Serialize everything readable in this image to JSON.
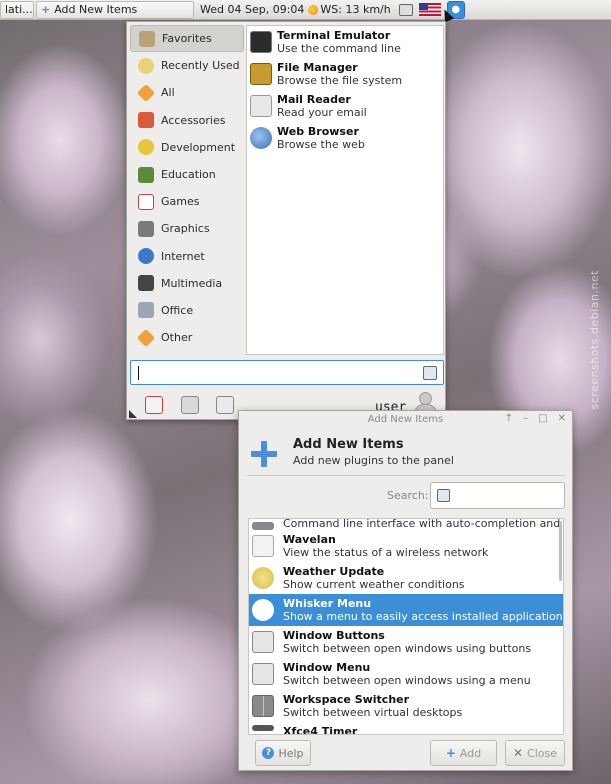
{
  "panel": {
    "task1_label": "lati...",
    "task2_label": "Add New Items",
    "clock": "Wed 04 Sep, 09:04",
    "weather": "WS: 13 km/h"
  },
  "menu": {
    "categories": [
      {
        "label": "Favorites",
        "icon": "favorites-icon",
        "color": "#b9a27a"
      },
      {
        "label": "Recently Used",
        "icon": "clock-icon",
        "color": "#e8d27a"
      },
      {
        "label": "All",
        "icon": "all-icon",
        "color": "#f0a03c"
      },
      {
        "label": "Accessories",
        "icon": "accessories-icon",
        "color": "#d95a3a"
      },
      {
        "label": "Development",
        "icon": "development-icon",
        "color": "#e8c63c"
      },
      {
        "label": "Education",
        "icon": "education-icon",
        "color": "#5a8a3a"
      },
      {
        "label": "Games",
        "icon": "games-icon",
        "color": "#c94040"
      },
      {
        "label": "Graphics",
        "icon": "graphics-icon",
        "color": "#7a7a7a"
      },
      {
        "label": "Internet",
        "icon": "internet-icon",
        "color": "#3c7ac9"
      },
      {
        "label": "Multimedia",
        "icon": "multimedia-icon",
        "color": "#444444"
      },
      {
        "label": "Office",
        "icon": "office-icon",
        "color": "#9aa6b5"
      },
      {
        "label": "Other",
        "icon": "other-icon",
        "color": "#f0a03c"
      }
    ],
    "apps": [
      {
        "title": "Terminal Emulator",
        "desc": "Use the command line",
        "icon": "terminal-icon",
        "color": "#2c2c2c"
      },
      {
        "title": "File Manager",
        "desc": "Browse the file system",
        "icon": "file-manager-icon",
        "color": "#c99a2e"
      },
      {
        "title": "Mail Reader",
        "desc": "Read your email",
        "icon": "mail-icon",
        "color": "#d8d8d8"
      },
      {
        "title": "Web Browser",
        "desc": "Browse the web",
        "icon": "web-browser-icon",
        "color": "#3c6fb5"
      }
    ],
    "search_value": "",
    "username": "user"
  },
  "dialog": {
    "window_title": "Add New Items",
    "heading": "Add New Items",
    "subheading": "Add new plugins to the panel",
    "search_label": "Search:",
    "search_value": "",
    "plugins": [
      {
        "title": "",
        "desc": "Command line interface with auto-completion and ...",
        "icon": "command-icon",
        "color": "#888888"
      },
      {
        "title": "Wavelan",
        "desc": "View the status of a wireless network",
        "icon": "wavelan-icon",
        "color": "#e6e6e6"
      },
      {
        "title": "Weather Update",
        "desc": "Show current weather conditions",
        "icon": "weather-icon",
        "color": "#e8d46a"
      },
      {
        "title": "Whisker Menu",
        "desc": "Show a menu to easily access installed applications",
        "icon": "whisker-icon",
        "color": "#3c8fd6"
      },
      {
        "title": "Window Buttons",
        "desc": "Switch between open windows using buttons",
        "icon": "window-buttons-icon",
        "color": "#dcdcdc"
      },
      {
        "title": "Window Menu",
        "desc": "Switch between open windows using a menu",
        "icon": "window-menu-icon",
        "color": "#dcdcdc"
      },
      {
        "title": "Workspace Switcher",
        "desc": "Switch between virtual desktops",
        "icon": "workspace-switcher-icon",
        "color": "#9a9a9a"
      },
      {
        "title": "Xfce4 Timer",
        "desc": "",
        "icon": "timer-icon",
        "color": "#555555"
      }
    ],
    "help_label": "Help",
    "add_label": "Add",
    "close_label": "Close"
  },
  "watermark": "screenshots.debian.net",
  "colors": {
    "accent": "#3c8fd6",
    "panel_bg": "#e6e4e0"
  }
}
